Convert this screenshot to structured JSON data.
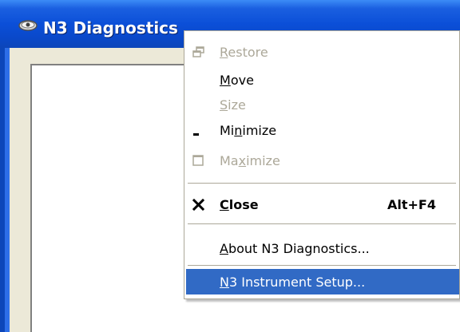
{
  "window": {
    "title": "N3 Diagnostics",
    "title_icon": "eye-icon"
  },
  "system_menu": {
    "items": [
      {
        "id": "restore",
        "label_pre": "",
        "label_u": "R",
        "label_post": "estore",
        "enabled": false,
        "icon": "restore-icon",
        "shortcut": ""
      },
      {
        "id": "move",
        "label_pre": "",
        "label_u": "M",
        "label_post": "ove",
        "enabled": true,
        "icon": "",
        "shortcut": ""
      },
      {
        "id": "size",
        "label_pre": "",
        "label_u": "S",
        "label_post": "ize",
        "enabled": false,
        "icon": "",
        "shortcut": ""
      },
      {
        "id": "minimize",
        "label_pre": "Mi",
        "label_u": "n",
        "label_post": "imize",
        "enabled": true,
        "icon": "minimize-icon",
        "shortcut": ""
      },
      {
        "id": "maximize",
        "label_pre": "Ma",
        "label_u": "x",
        "label_post": "imize",
        "enabled": false,
        "icon": "maximize-icon",
        "shortcut": ""
      },
      {
        "id": "close",
        "label_pre": "",
        "label_u": "C",
        "label_post": "lose",
        "enabled": true,
        "icon": "close-icon",
        "shortcut": "Alt+F4"
      },
      {
        "id": "about",
        "label_pre": "",
        "label_u": "A",
        "label_post": "bout N3 Diagnostics...",
        "enabled": true,
        "icon": "",
        "shortcut": ""
      },
      {
        "id": "instrument_setup",
        "label_pre": "",
        "label_u": "N",
        "label_post": "3 Instrument Setup...",
        "enabled": true,
        "icon": "",
        "shortcut": "",
        "highlighted": true
      }
    ]
  },
  "colors": {
    "titlebar": "#0b4fd8",
    "menu_highlight": "#316ac5",
    "disabled_text": "#aca899"
  }
}
